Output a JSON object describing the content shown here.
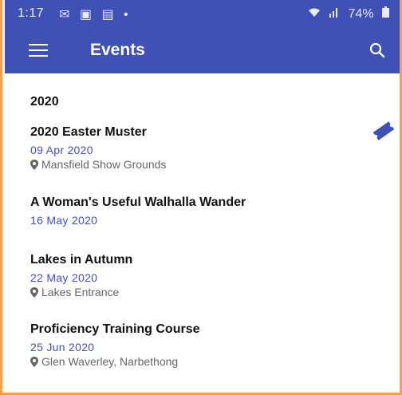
{
  "status_bar": {
    "time": "1:17",
    "notification_icons": [
      "mail-icon",
      "image-icon",
      "calendar-icon",
      "dot-icon"
    ],
    "battery": "74%"
  },
  "app_bar": {
    "title": "Events"
  },
  "year_header": "2020",
  "events": [
    {
      "title": "2020 Easter Muster",
      "date": "09 Apr 2020",
      "location": "Mansfield Show Grounds",
      "has_ticket": true
    },
    {
      "title": "A Woman's Useful Walhalla Wander",
      "date": "16 May 2020"
    },
    {
      "title": "Lakes in Autumn",
      "date": "22 May 2020",
      "location": "Lakes Entrance"
    },
    {
      "title": "Proficiency Training Course",
      "date": "25 Jun 2020",
      "location": "Glen Waverley, Narbethong"
    }
  ],
  "colors": {
    "primary": "#3f51b5",
    "frame_border": "#f3a24a"
  }
}
